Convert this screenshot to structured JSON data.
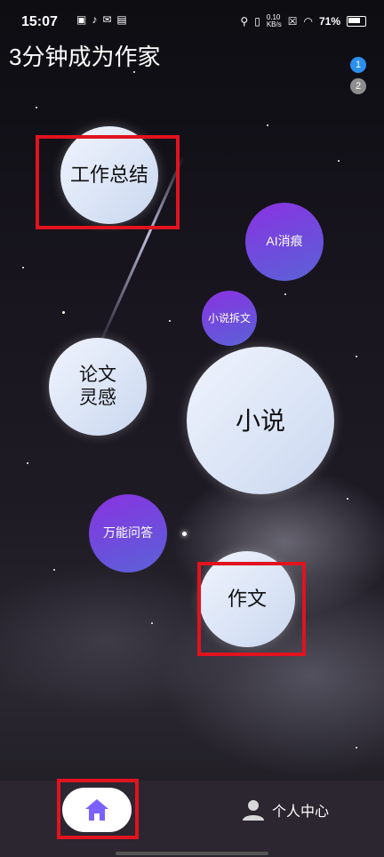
{
  "status_bar": {
    "time": "15:07",
    "network_speed": "0.10\nKB/s",
    "battery": "71%"
  },
  "app": {
    "title": "3分钟成为作家"
  },
  "page_indicator": [
    "1",
    "2"
  ],
  "bubbles": {
    "work_summary": "工作总结",
    "ai_deaigc": "AI消痕",
    "novel_split": "小说拆文",
    "paper_inspiration": "论文\n灵感",
    "novel": "小说",
    "qa": "万能问答",
    "essay": "作文"
  },
  "nav": {
    "profile_label": "个人中心"
  },
  "colors": {
    "accent": "#7b61ff",
    "highlight": "#e0131f",
    "bubble_purple": "#8a32e1"
  }
}
